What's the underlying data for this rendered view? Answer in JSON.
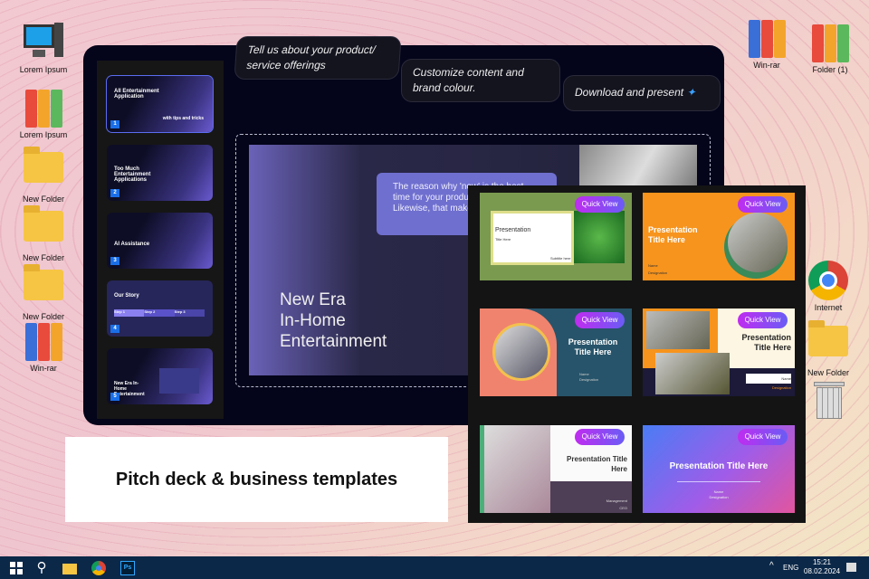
{
  "desktop_left": [
    {
      "label": "Lorem Ipsum",
      "icon": "computer-icon"
    },
    {
      "label": "Lorem Ipsum",
      "icon": "binders-icon"
    },
    {
      "label": "New Folder",
      "icon": "folder-icon"
    },
    {
      "label": "New Folder",
      "icon": "folder-icon"
    },
    {
      "label": "New Folder",
      "icon": "folder-icon"
    },
    {
      "label": "Win-rar",
      "icon": "winrar-icon"
    }
  ],
  "desktop_right": [
    {
      "label": "Win-rar"
    },
    {
      "label": "Folder (1)"
    },
    {
      "label": "Internet"
    },
    {
      "label": "New Folder"
    }
  ],
  "callouts": [
    "Tell us about your product/ service offerings",
    "Customize content and brand colour.",
    "Download and present"
  ],
  "thumbnails": [
    {
      "num": "1",
      "title": "All Entertainment Application",
      "extra": "with tips and tricks"
    },
    {
      "num": "2",
      "title": "Too Much Entertainment Applications"
    },
    {
      "num": "3",
      "title": "AI Assistance"
    },
    {
      "num": "4",
      "title": "Our Story",
      "steps": [
        "Step 1",
        "Step 2",
        "Step 3"
      ]
    },
    {
      "num": "5",
      "title": "New Era In-Home Entertainment"
    }
  ],
  "slide": {
    "title_lines": [
      "New Era",
      "In-Home",
      "Entertainment"
    ],
    "quote": "The reason why 'now' is the best time for your product/ service. Likewise, that makes them p"
  },
  "templates": {
    "quick_view": "Quick View",
    "cards": [
      {
        "title": "Presentation",
        "sub": "Title Here",
        "foot": "Subtitle here"
      },
      {
        "title": "Presentation Title Here",
        "sub": "Name",
        "foot": "Designation"
      },
      {
        "title": "Presentation Title Here",
        "sub": "Name",
        "foot": "Designation"
      },
      {
        "title": "Presentation Title Here",
        "sub": "Name",
        "foot": "Designation"
      },
      {
        "title": "Presentation Title Here",
        "sub": "Management",
        "foot": "CEO"
      },
      {
        "title": "Presentation Title Here",
        "sub": "Name",
        "foot": "Designation"
      }
    ]
  },
  "banner": "Pitch deck & business templates",
  "taskbar": {
    "lang": "ENG",
    "time": "15:21",
    "date": "08.02.2024"
  }
}
